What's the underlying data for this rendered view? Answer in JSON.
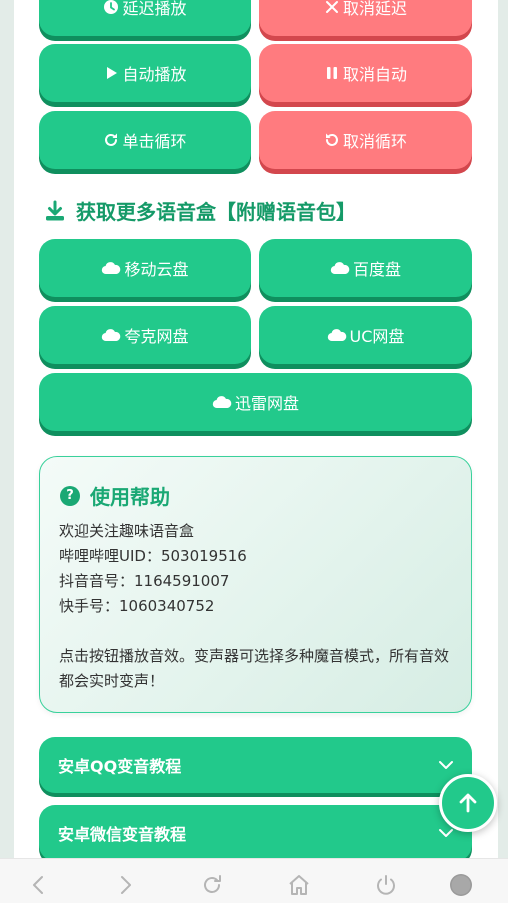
{
  "controls": {
    "delay_play": "延迟播放",
    "cancel_delay": "取消延迟",
    "auto_play": "自动播放",
    "cancel_auto": "取消自动",
    "single_loop": "单击循环",
    "cancel_loop": "取消循环"
  },
  "download": {
    "title": "获取更多语音盒【附赠语音包】",
    "mobile_cloud": "移动云盘",
    "baidu": "百度盘",
    "quark": "夸克网盘",
    "uc": "UC网盘",
    "xunlei": "迅雷网盘"
  },
  "help": {
    "title": "使用帮助",
    "lines": [
      "欢迎关注趣味语音盒",
      "哔哩哔哩UID：503019516",
      "抖音音号：1164591007",
      "快手号：1060340752"
    ],
    "paragraph": "点击按钮播放音效。变声器可选择多种魔音模式，所有音效都会实时变声！"
  },
  "tutorials": [
    "安卓QQ变音教程",
    "安卓微信变音教程"
  ],
  "colors": {
    "green": "#22c98b",
    "green_dark": "#0f8f5e",
    "red": "#ff7b7f",
    "red_dark": "#d3474d"
  },
  "icons": {
    "delay": "clock-icon",
    "cancel_delay": "close-icon",
    "auto": "play-icon",
    "cancel_auto": "pause-icon",
    "loop": "redo-icon",
    "cancel_loop": "undo-icon",
    "download": "download-icon",
    "cloud": "cloud-icon",
    "help": "question-circle-icon",
    "chevron": "chevron-down-icon",
    "top": "arrow-up-icon"
  }
}
